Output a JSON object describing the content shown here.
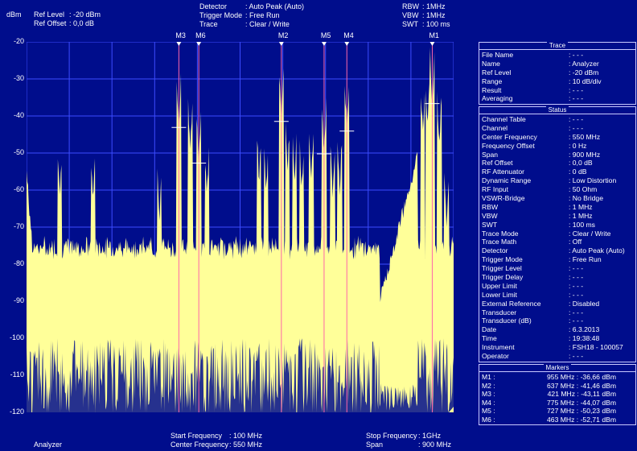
{
  "header": {
    "unit": "dBm",
    "ref_level_label": "Ref Level",
    "ref_level_value": ": -20   dBm",
    "ref_offset_label": "Ref Offset",
    "ref_offset_value": ": 0,0 dB",
    "detector_label": "Detector",
    "detector_value": ": Auto Peak (Auto)",
    "trigger_mode_label": "Trigger Mode",
    "trigger_mode_value": ": Free Run",
    "trace_label": "Trace",
    "trace_value": ": Clear / Write",
    "rbw_label": "RBW",
    "rbw_value": ":    1MHz",
    "vbw_label": "VBW",
    "vbw_value": ":    1MHz",
    "swt_label": "SWT",
    "swt_value": ": 100 ms"
  },
  "y_ticks": [
    "-20",
    "-30",
    "-40",
    "-50",
    "-60",
    "-70",
    "-80",
    "-90",
    "-100",
    "-110",
    "-120"
  ],
  "chart_data": {
    "type": "line",
    "xlim": [
      100,
      1000
    ],
    "ylim": [
      -120,
      -20
    ],
    "grid": true,
    "trace_color": "#ffff99",
    "markers": [
      {
        "label": "M1",
        "freq": 955,
        "level": -36.66
      },
      {
        "label": "M2",
        "freq": 637,
        "level": -41.46
      },
      {
        "label": "M3",
        "freq": 421,
        "level": -43.11
      },
      {
        "label": "M4",
        "freq": 775,
        "level": -44.07
      },
      {
        "label": "M5",
        "freq": 727,
        "level": -50.23
      },
      {
        "label": "M6",
        "freq": 463,
        "level": -52.71
      }
    ]
  },
  "footer": {
    "start_label": "Start Frequency",
    "start_value": ":  100 MHz",
    "center_label": "Center Frequency",
    "center_value": ": 550 MHz",
    "stop_label": "Stop Frequency",
    "stop_value": ":     1GHz",
    "span_label": "Span",
    "span_value": ": 900 MHz",
    "mode": "Analyzer"
  },
  "trace_panel": {
    "title": "Trace",
    "rows": [
      {
        "k": "File Name",
        "v": ": - - -"
      },
      {
        "k": "Name",
        "v": ": Analyzer"
      },
      {
        "k": "Ref Level",
        "v": ":    -20      dBm"
      },
      {
        "k": "Range",
        "v": ": 10 dB/div"
      },
      {
        "k": "Result",
        "v": ": - - -"
      },
      {
        "k": "Averaging",
        "v": ": - - -"
      }
    ]
  },
  "status_panel": {
    "title": "Status",
    "rows": [
      {
        "k": "Channel Table",
        "v": ": - - -"
      },
      {
        "k": "Channel",
        "v": ": - - -"
      },
      {
        "k": "Center Frequency",
        "v": ":  550     MHz"
      },
      {
        "k": "Frequency Offset",
        "v": ":      0     Hz"
      },
      {
        "k": "Span",
        "v": ":  900     MHz"
      },
      {
        "k": "Ref Offset",
        "v": ":     0,0    dB"
      },
      {
        "k": "RF Attenuator",
        "v": ":      0     dB"
      },
      {
        "k": "Dynamic Range",
        "v": ": Low Distortion"
      },
      {
        "k": "RF Input",
        "v": ":    50     Ohm"
      },
      {
        "k": "VSWR-Bridge",
        "v": ": No Bridge"
      },
      {
        "k": "RBW",
        "v": ":      1     MHz"
      },
      {
        "k": "VBW",
        "v": ":      1     MHz"
      },
      {
        "k": "SWT",
        "v": ":   100     ms"
      },
      {
        "k": "Trace Mode",
        "v": ": Clear / Write"
      },
      {
        "k": "Trace Math",
        "v": ": Off"
      },
      {
        "k": "Detector",
        "v": ": Auto Peak (Auto)"
      },
      {
        "k": "Trigger Mode",
        "v": ": Free Run"
      },
      {
        "k": "Trigger Level",
        "v": ": - - -"
      },
      {
        "k": "Trigger Delay",
        "v": ": - - -"
      },
      {
        "k": "Upper Limit",
        "v": ": - - -"
      },
      {
        "k": "Lower Limit",
        "v": ": - - -"
      },
      {
        "k": "External Reference",
        "v": ": Disabled"
      },
      {
        "k": "Transducer",
        "v": ": - - -"
      },
      {
        "k": "Transducer (dB)",
        "v": ": - - -"
      },
      {
        "k": "Date",
        "v": ": 6.3.2013"
      },
      {
        "k": "Time",
        "v": ": 19:38:48"
      },
      {
        "k": "Instrument",
        "v": ": FSH18 - 100057"
      },
      {
        "k": "Operator",
        "v": ": - - -"
      }
    ]
  },
  "markers_panel": {
    "title": "Markers",
    "rows": [
      {
        "k": "M1 :",
        "v": "955 MHz : -36,66 dBm"
      },
      {
        "k": "M2 :",
        "v": "637 MHz : -41,46 dBm"
      },
      {
        "k": "M3 :",
        "v": "421 MHz :  -43,11 dBm"
      },
      {
        "k": "M4 :",
        "v": "775 MHz : -44,07 dBm"
      },
      {
        "k": "M5 :",
        "v": "727 MHz : -50,23 dBm"
      },
      {
        "k": "M6 :",
        "v": "463 MHz : -52,71 dBm"
      }
    ]
  }
}
